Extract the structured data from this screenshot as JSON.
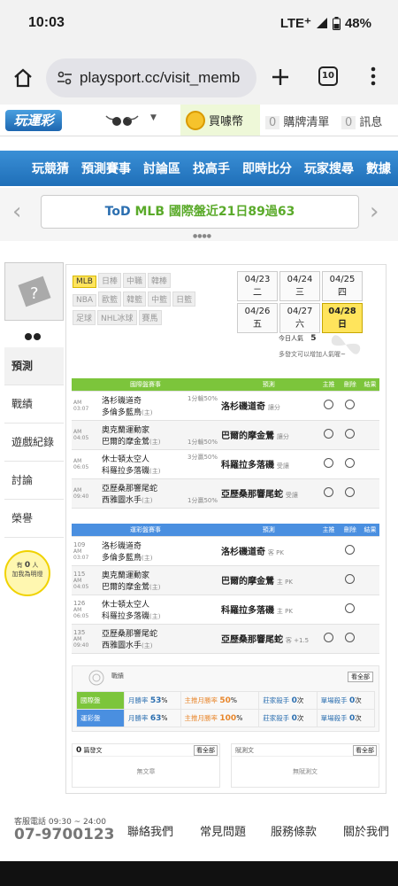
{
  "status": {
    "time": "10:03",
    "network": "LTE⁺",
    "battery": "48%"
  },
  "browser": {
    "url": "playsport.cc/visit_memb",
    "tab_count": "10"
  },
  "site": {
    "logo": "玩運彩",
    "coin_label": "買噱幣",
    "cart_count": "0",
    "cart_label": "購牌清單",
    "msg_count": "0",
    "msg_label": "訊息"
  },
  "nav": {
    "items": [
      "玩競猜",
      "預測賽事",
      "討論區",
      "找高手",
      "即時比分",
      "玩家搜尋",
      "數據"
    ]
  },
  "banner": {
    "text_a": "ToD ",
    "text_b": "MLB",
    "text_c": " 國際盤近21日89過63"
  },
  "sidebar": {
    "items": [
      "預測",
      "戰績",
      "遊戲紀錄",
      "討論",
      "榮譽"
    ],
    "likes_prefix": "有",
    "likes_count": "0",
    "likes_suffix": "人",
    "likes_line2": "加我為明燈"
  },
  "leagues": {
    "row1": [
      "MLB",
      "日棒",
      "中職",
      "韓棒"
    ],
    "row2": [
      "NBA",
      "歐籃",
      "韓籃",
      "中籃",
      "日籃"
    ],
    "row3": [
      "足球",
      "NHL冰球",
      "賽馬"
    ]
  },
  "dates": [
    {
      "d": "04/23",
      "w": "二"
    },
    {
      "d": "04/24",
      "w": "三"
    },
    {
      "d": "04/25",
      "w": "四"
    },
    {
      "d": "04/26",
      "w": "五"
    },
    {
      "d": "04/27",
      "w": "六"
    },
    {
      "d": "04/28",
      "w": "日"
    }
  ],
  "popularity": {
    "label": "今日人氣",
    "value": "5",
    "note": "多發文可以增加人氣喔~"
  },
  "intl": {
    "headers": [
      "國際盤賽事",
      "預測",
      "主推",
      "刪除",
      "結果"
    ],
    "games": [
      {
        "time": "AM 03:07",
        "team1": "洛杉磯道奇",
        "team2": "多倫多藍鳥",
        "t2mark": "(主)",
        "line": "1分輸50%",
        "pick": "洛杉磯道奇",
        "pick_note": "讓分"
      },
      {
        "time": "AM 04:05",
        "team1": "奧克蘭運動家",
        "team2": "巴爾的摩金鶯",
        "t2mark": "(主)",
        "line": "1分輸50%",
        "pick": "巴爾的摩金鶯",
        "pick_note": "讓分"
      },
      {
        "time": "AM 06:05",
        "team1": "休士頓太空人",
        "team2": "科羅拉多落磯",
        "t2mark": "(主)",
        "line": "3分贏50%",
        "pick": "科羅拉多落磯",
        "pick_note": "受讓"
      },
      {
        "time": "AM 09:40",
        "team1": "亞歷桑那響尾蛇",
        "team2": "西雅圖水手",
        "t2mark": "(主)",
        "line": "1分贏50%",
        "pick": "亞歷桑那響尾蛇",
        "pick_note": "受讓"
      }
    ]
  },
  "tw": {
    "headers": [
      "運彩盤賽事",
      "預測",
      "主推",
      "刪除",
      "結果"
    ],
    "games": [
      {
        "num": "109",
        "time": "AM 03:07",
        "team1": "洛杉磯道奇",
        "team2": "多倫多藍鳥",
        "t2mark": "(主)",
        "pick": "洛杉磯道奇",
        "pick_note": "客 PK"
      },
      {
        "num": "115",
        "time": "AM 04:05",
        "team1": "奧克蘭運動家",
        "team2": "巴爾的摩金鶯",
        "t2mark": "(主)",
        "pick": "巴爾的摩金鶯",
        "pick_note": "主 PK"
      },
      {
        "num": "126",
        "time": "AM 06:05",
        "team1": "休士頓太空人",
        "team2": "科羅拉多落磯",
        "t2mark": "(主)",
        "pick": "科羅拉多落磯",
        "pick_note": "主 PK"
      },
      {
        "num": "135",
        "time": "AM 09:40",
        "team1": "亞歷桑那響尾蛇",
        "team2": "西雅圖水手",
        "t2mark": "(主)",
        "pick": "亞歷桑那響尾蛇",
        "pick_note": "客 +1.5"
      }
    ]
  },
  "record": {
    "title": "戰績",
    "view_all": "看全部",
    "rows": [
      {
        "label": "國際盤",
        "month_label": "月勝率",
        "month": "53",
        "main_label": "主推月勝率",
        "main": "50",
        "season_label": "莊家殺手",
        "season": "0",
        "single_label": "單場殺手",
        "single": "0",
        "unit": "次"
      },
      {
        "label": "運彩盤",
        "month_label": "月勝率",
        "month": "63",
        "main_label": "主推月勝率",
        "main": "100",
        "season_label": "莊家殺手",
        "season": "0",
        "single_label": "單場殺手",
        "single": "0",
        "unit": "次"
      }
    ],
    "pct": "%"
  },
  "posts": {
    "count": "0",
    "label": "篇發文",
    "empty": "無文章",
    "view_all": "看全部"
  },
  "replies": {
    "label": "賦測文",
    "empty": "無賦測文",
    "view_all": "看全部"
  },
  "footer": {
    "phone_label": "客服電話 09:30 ~ 24:00",
    "phone": "07-9700123",
    "links": [
      "聯絡我們",
      "常見問題",
      "服務條款",
      "關於我們"
    ]
  }
}
